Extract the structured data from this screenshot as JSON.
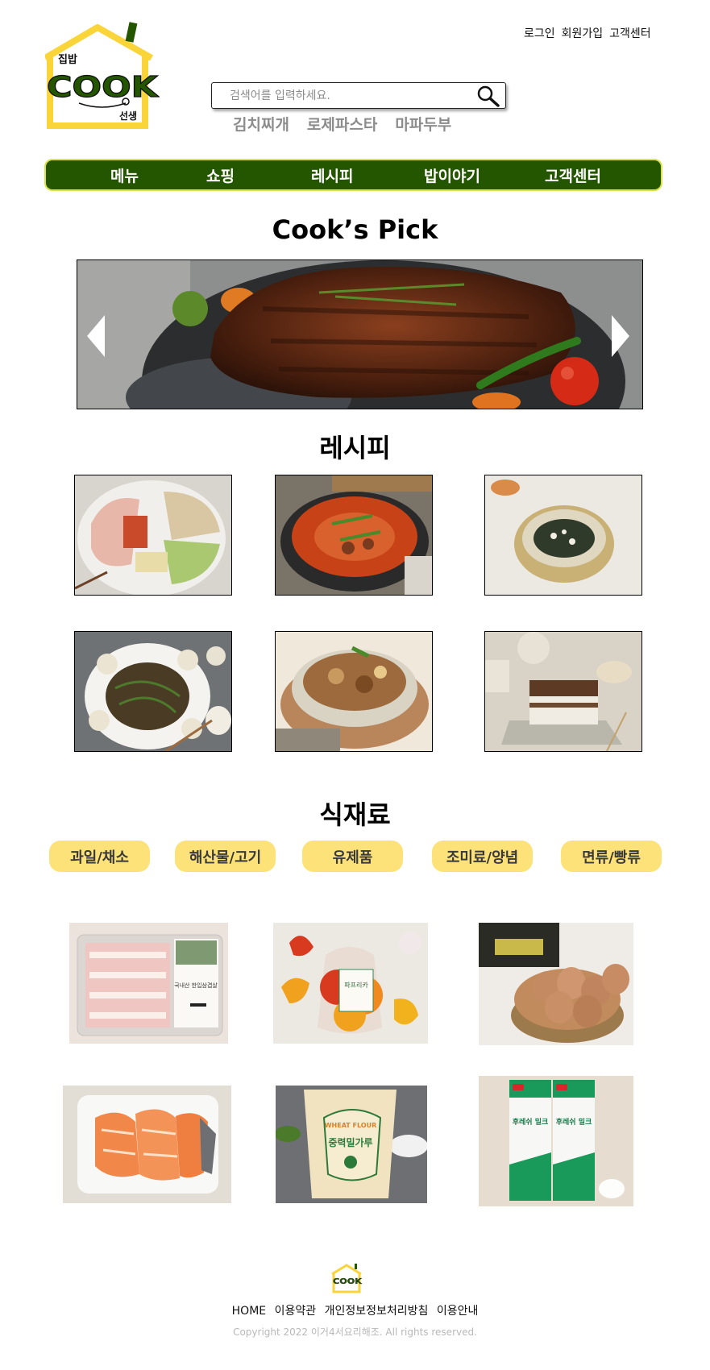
{
  "brand": {
    "logo_small_text": "집밥",
    "logo_main_text": "COOK",
    "logo_sub_text": "선생",
    "primary_green": "#245600",
    "accent_yellow": "#fde27a",
    "logo_yellow": "#f9d53a"
  },
  "header": {
    "links": [
      "로그인",
      "회원가입",
      "고객센터"
    ],
    "search": {
      "placeholder": "검색어를 입력하세요.",
      "value": ""
    },
    "popular_keywords": [
      "김치찌개",
      "로제파스타",
      "마파두부"
    ]
  },
  "nav": {
    "items": [
      "메뉴",
      "쇼핑",
      "레시피",
      "밥이야기",
      "고객센터"
    ]
  },
  "pick": {
    "title": "Cook’s Pick",
    "image": "grilled-steak-photo"
  },
  "recipes": {
    "title": "레시피",
    "items": [
      "boiled-pork-platter-photo",
      "spicy-stew-pot-photo",
      "seaweed-rice-bowl-photo",
      "japchae-dumplings-photo",
      "braised-chicken-pot-photo",
      "tiramisu-cake-photo"
    ]
  },
  "ingredients": {
    "title": "식재료",
    "categories": [
      "과일/채소",
      "해산물/고기",
      "유제품",
      "조미료/양념",
      "면류/빵류"
    ],
    "products": [
      {
        "image": "pork-belly-pack-photo",
        "pack_label": "국내산 한입삼겹살"
      },
      {
        "image": "paprika-bag-photo",
        "pack_label": "파프리카"
      },
      {
        "image": "egg-basket-photo",
        "pack_label": ""
      },
      {
        "image": "salmon-fillet-photo",
        "pack_label": ""
      },
      {
        "image": "flour-bag-photo",
        "pack_label": "중력밀가루",
        "pack_label_en": "WHEAT FLOUR"
      },
      {
        "image": "fresh-milk-cartons-photo",
        "pack_label": "후레쉬 밀크"
      }
    ]
  },
  "footer": {
    "links": [
      "HOME",
      "이용약관",
      "개인정보정보처리방침",
      "이용안내"
    ],
    "copyright": "Copyright 2022 이거4서요리해조. All rights reserved."
  }
}
